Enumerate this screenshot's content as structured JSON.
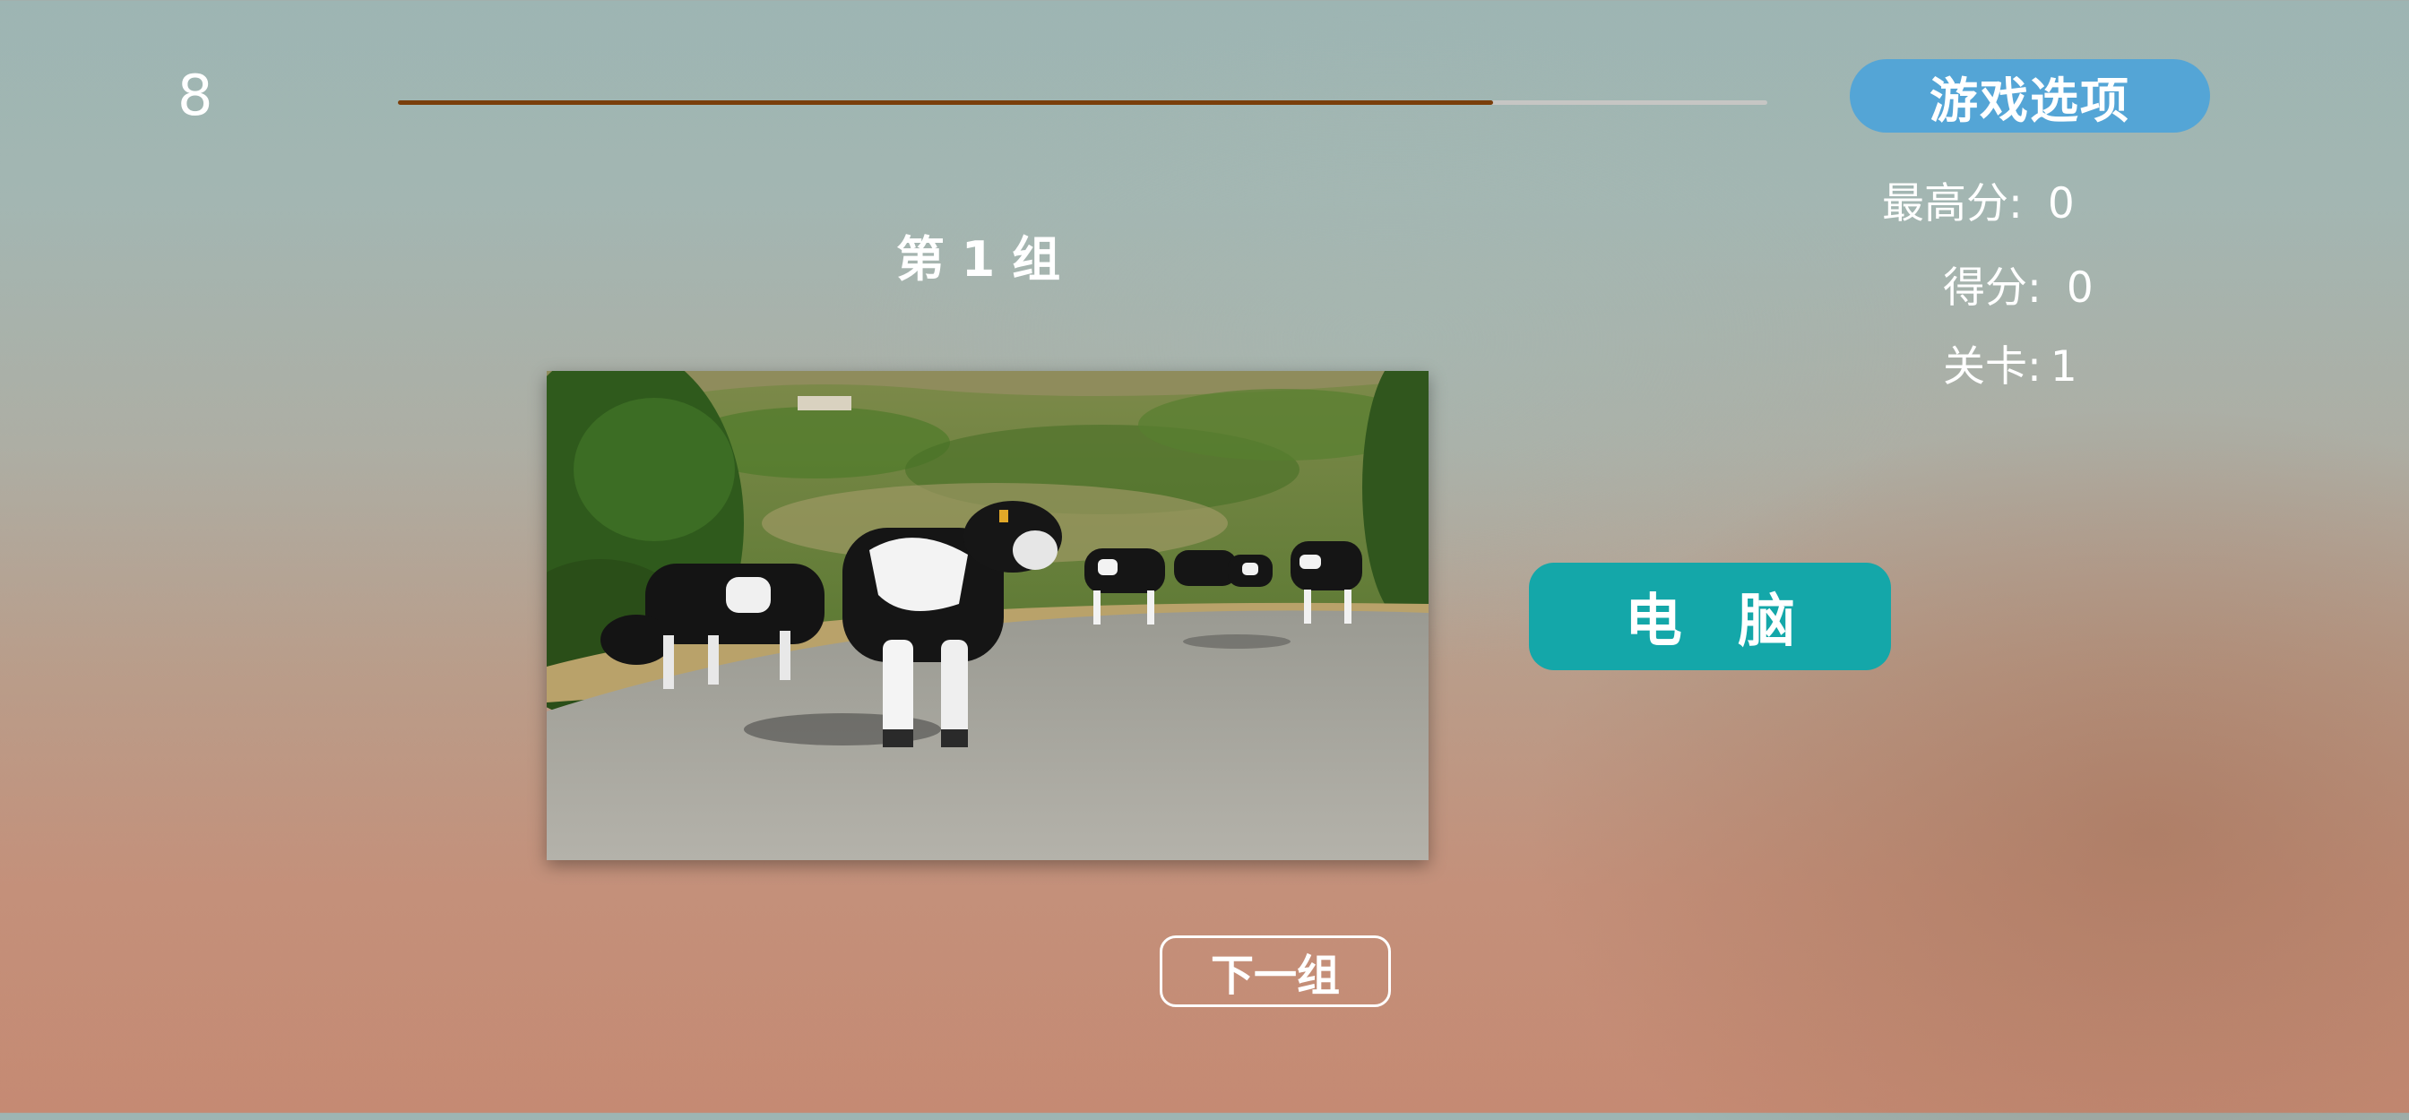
{
  "timer": "8",
  "progress": 0.8,
  "colors": {
    "progress_fill": "#7a3e0b",
    "progress_track": "#c6c6c4",
    "options_button": "#54a5d6",
    "answer_button": "#14a7a9"
  },
  "options_button": "游戏选项",
  "stats": {
    "high_score_label": "最高分:",
    "high_score_value": "0",
    "score_label": "得分:",
    "score_value": "0",
    "level_label": "关卡:",
    "level_value": "1"
  },
  "group_title": "第 1 组",
  "photo": {
    "subject": "herd of black-and-white dairy cows walking on a rural road with green hills"
  },
  "answer_button": "电 脑",
  "next_button": "下一组"
}
